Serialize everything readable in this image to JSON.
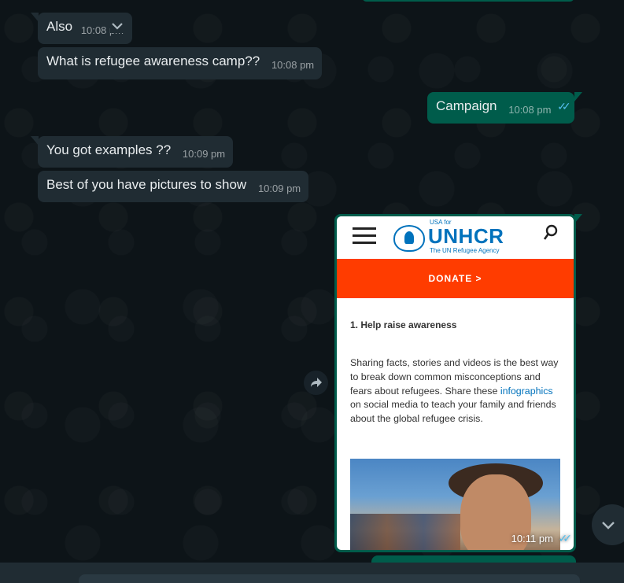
{
  "messages": [
    {
      "text": "Also",
      "time": "10:08 pm"
    },
    {
      "text": "What is refugee awareness camp??",
      "time": "10:08 pm"
    },
    {
      "text": "Campaign",
      "time": "10:08 pm"
    },
    {
      "text": "You got examples ??",
      "time": "10:09 pm"
    },
    {
      "text": "Best of you have pictures to show",
      "time": "10:09 pm"
    }
  ],
  "image_message": {
    "time": "10:11 pm",
    "site": {
      "logo_top": "USA for",
      "logo_word": "UNHCR",
      "logo_tagline": "The UN Refugee Agency",
      "donate": "DONATE >",
      "heading": "1. Help raise awareness",
      "para_before_link": "Sharing facts, stories and videos is the best way to break down common misconceptions and fears about refugees. Share these ",
      "link": "infographics",
      "para_after_link": " on social media to teach your family and friends about the global refugee crisis."
    }
  },
  "icons": {
    "chevron": "chevron-down-icon",
    "ticks": "double-check-icon",
    "forward": "forward-icon",
    "scroll": "scroll-down-icon"
  },
  "colors": {
    "incoming": "#202c33",
    "outgoing": "#005c4b",
    "background": "#0b141a",
    "read_ticks": "#53bdeb",
    "donate": "#ff3c00",
    "unhcr_blue": "#0072bc"
  }
}
